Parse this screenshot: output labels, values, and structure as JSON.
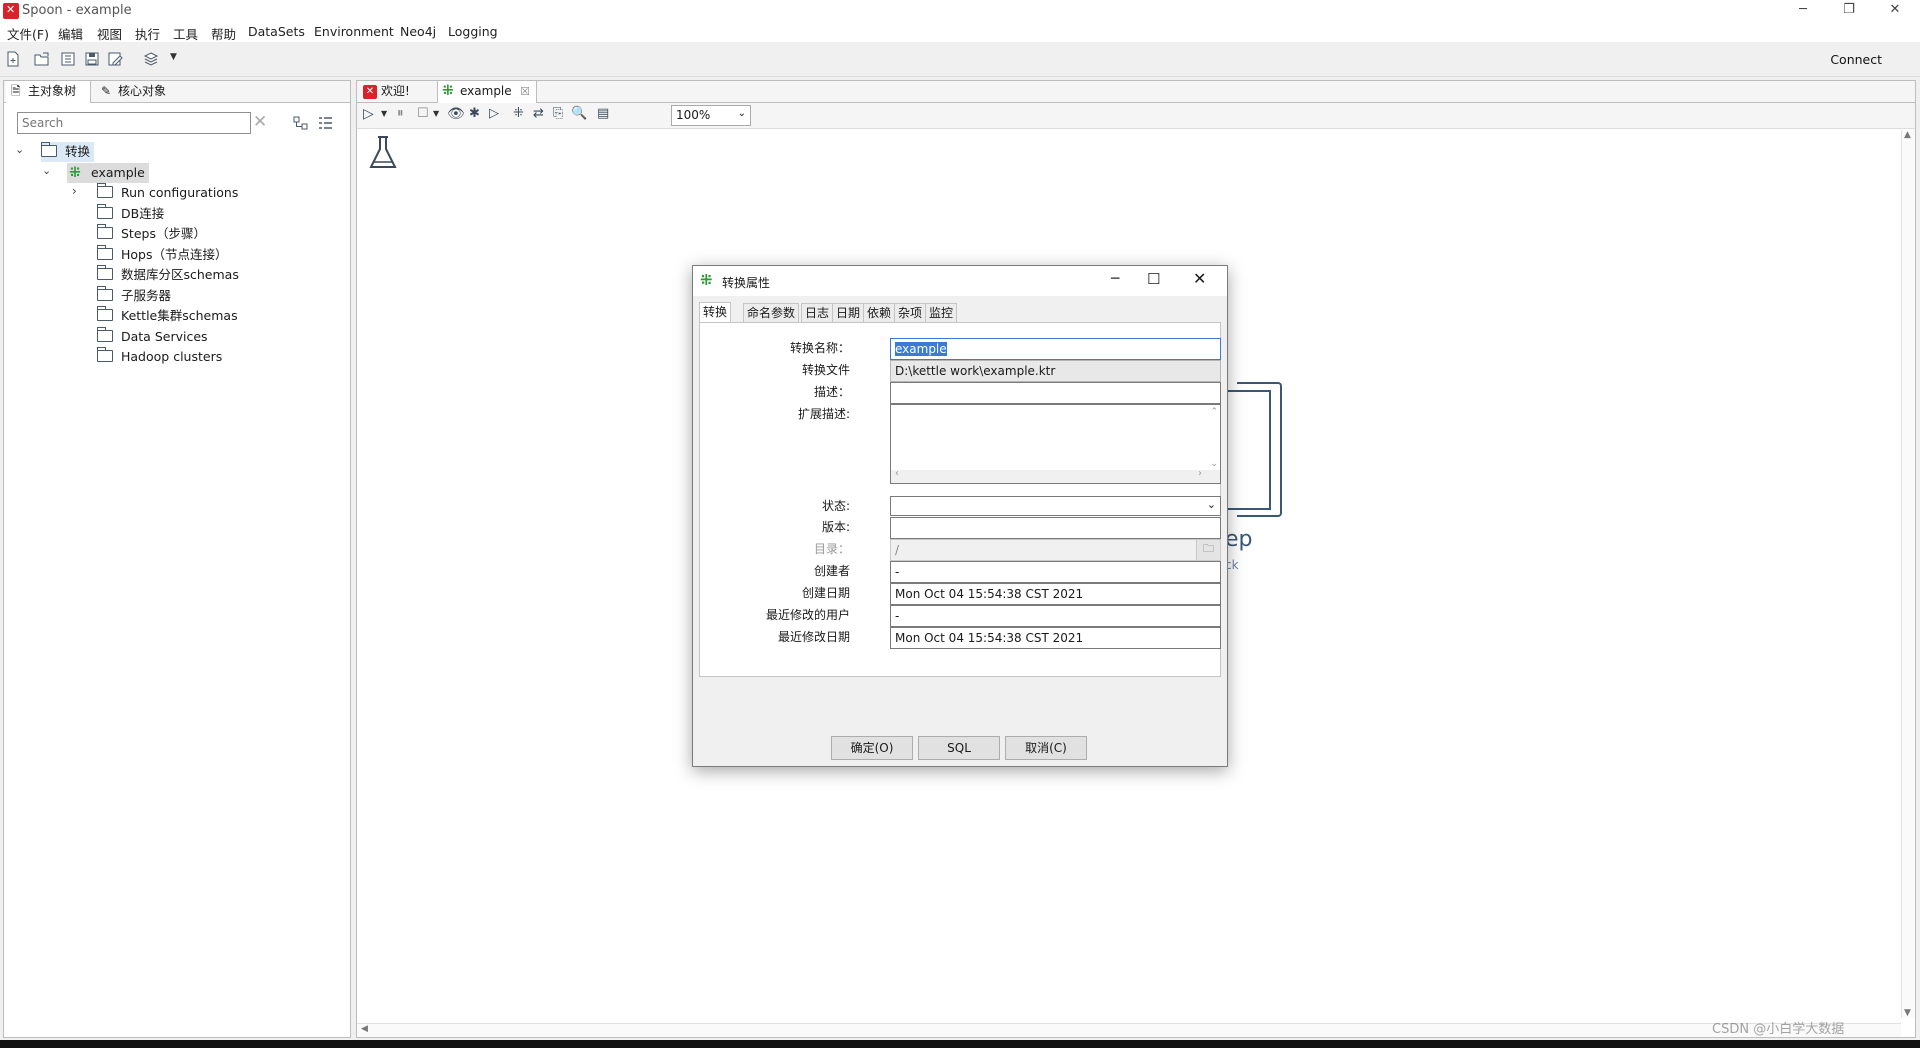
{
  "window": {
    "title": "Spoon - example"
  },
  "menu": [
    "文件(F)",
    "编辑",
    "视图",
    "执行",
    "工具",
    "帮助",
    "DataSets",
    "Environment",
    "Neo4j",
    "Logging"
  ],
  "toolbar": {
    "connect_label": "Connect"
  },
  "left_panel": {
    "tabs": [
      "主对象树",
      "核心对象"
    ],
    "search_placeholder": "Search",
    "root_label": "转换",
    "transformation_label": "example",
    "items": [
      "Run configurations",
      "DB连接",
      "Steps（步骤）",
      "Hops（节点连接）",
      "数据库分区schemas",
      "子服务器",
      "Kettle集群schemas",
      "Data Services",
      "Hadoop clusters"
    ]
  },
  "editor": {
    "tabs": [
      "欢迎!",
      "example"
    ],
    "zoom": "100%",
    "canvas_hint_fragments": [
      "ep",
      "ck"
    ]
  },
  "dialog": {
    "title": "转换属性",
    "tabs": [
      "转换",
      "命名参数",
      "日志",
      "日期",
      "依赖",
      "杂项",
      "监控"
    ],
    "fields": {
      "name_label": "转换名称：",
      "name_value": "example",
      "file_label": "转换文件",
      "file_value": "D:\\kettle work\\example.ktr",
      "desc_label": "描述：",
      "ext_desc_label": "扩展描述:",
      "status_label": "状态:",
      "version_label": "版本:",
      "dir_label": "目录：",
      "dir_value": "/",
      "creator_label": "创建者",
      "creator_value": "-",
      "created_label": "创建日期",
      "created_value": "Mon Oct 04 15:54:38 CST 2021",
      "modified_by_label": "最近修改的用户",
      "modified_by_value": "-",
      "modified_label": "最近修改日期",
      "modified_value": "Mon Oct 04 15:54:38 CST 2021"
    },
    "buttons": {
      "ok": "确定(O)",
      "sql": "SQL",
      "cancel": "取消(C)"
    }
  },
  "watermark": "CSDN @小白学大数据"
}
